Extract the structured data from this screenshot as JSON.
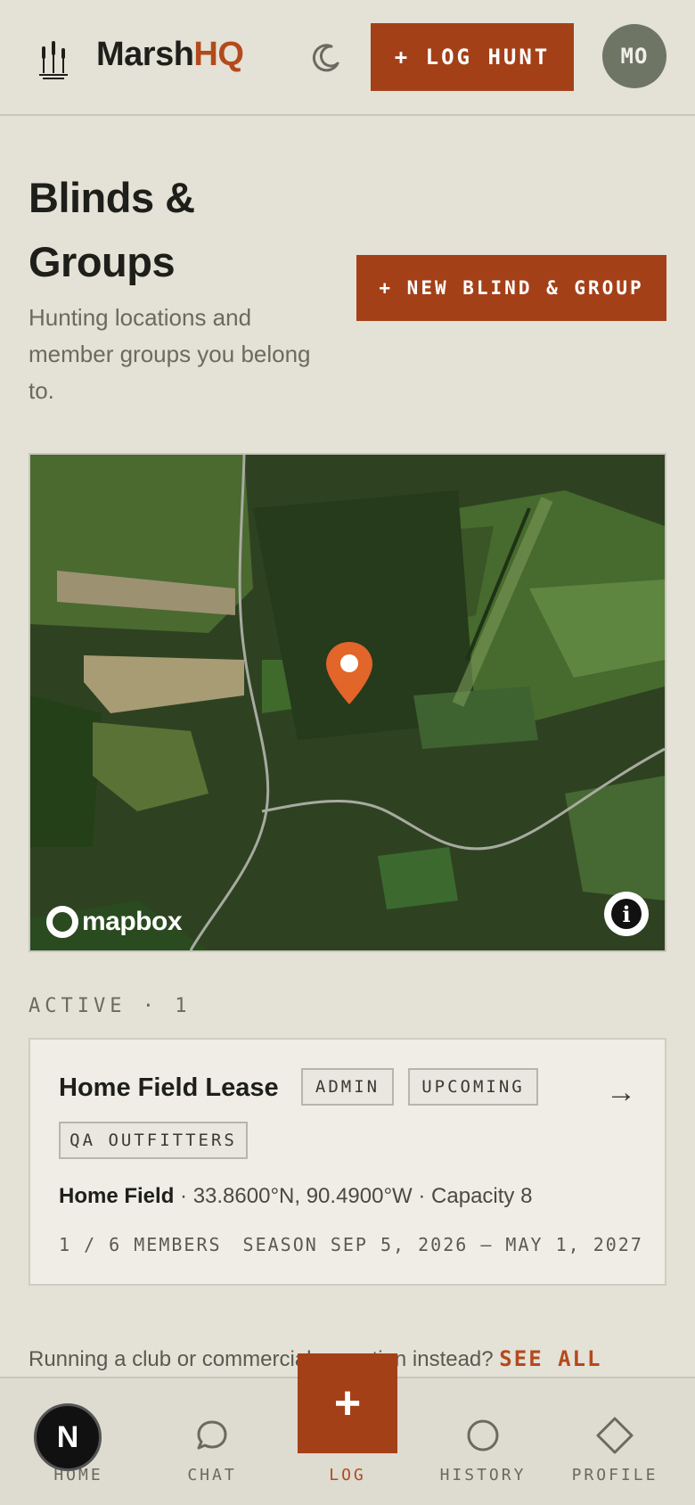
{
  "header": {
    "brand_main": "Marsh",
    "brand_accent": "HQ",
    "log_hunt_label": "+ LOG HUNT",
    "avatar_initials": "MO"
  },
  "page": {
    "title": "Blinds & Groups",
    "subtitle": "Hunting locations and member groups you belong to.",
    "new_button_label": "+ NEW BLIND & GROUP"
  },
  "map": {
    "attribution": "mapbox",
    "info_symbol": "i"
  },
  "active_section": {
    "label": "ACTIVE · 1"
  },
  "groups": [
    {
      "name": "Home Field Lease",
      "tags": [
        "ADMIN",
        "UPCOMING",
        "QA OUTFITTERS"
      ],
      "location_name": "Home Field",
      "location_details": " · 33.8600°N, 90.4900°W · Capacity 8",
      "members": "1 / 6 MEMBERS",
      "season": "SEASON SEP 5, 2026 – MAY 1, 2027",
      "arrow": "→"
    }
  ],
  "footer_note": {
    "text": "Running a club or commercial operation instead?",
    "link": "SEE ALL"
  },
  "bottom_nav": {
    "items": [
      {
        "label": "HOME",
        "icon": "home-icon"
      },
      {
        "label": "CHAT",
        "icon": "chat-icon"
      },
      {
        "label": "LOG",
        "icon": "plus-icon"
      },
      {
        "label": "HISTORY",
        "icon": "circle-icon"
      },
      {
        "label": "PROFILE",
        "icon": "diamond-icon"
      }
    ],
    "fab_symbol": "+",
    "dev_badge": "N"
  },
  "colors": {
    "accent": "#a44018",
    "brand_accent": "#b34a1c",
    "background": "#e4e1d6",
    "card": "#efede6"
  }
}
